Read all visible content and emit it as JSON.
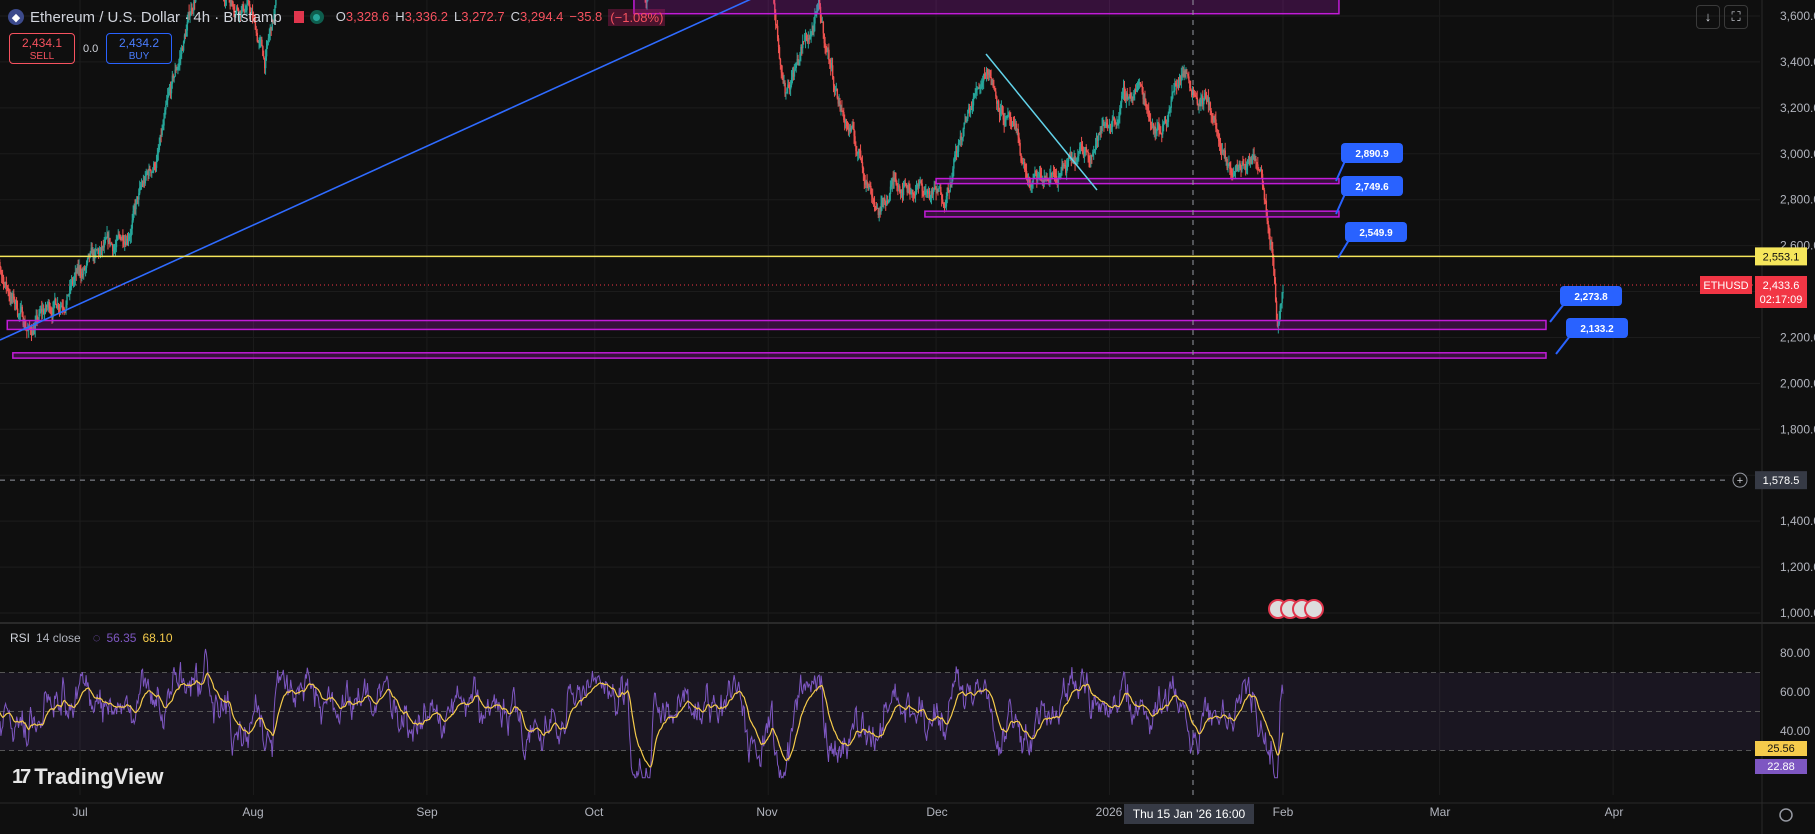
{
  "header": {
    "symbol_title": "Ethereum / U.S. Dollar · 4h · Bitstamp",
    "open_label": "O",
    "open": "3,328.6",
    "high_label": "H",
    "high": "3,336.2",
    "low_label": "L",
    "low": "3,272.7",
    "close_label": "C",
    "close": "3,294.4",
    "change": "−35.8",
    "change_pct": "(−1.08%)"
  },
  "trade": {
    "sell_price": "2,434.1",
    "sell_label": "SELL",
    "spread": "0.0",
    "buy_price": "2,434.2",
    "buy_label": "BUY"
  },
  "right_controls": {
    "down_icon": "arrow-down-icon",
    "screen_icon": "screen-icon"
  },
  "price_axis": {
    "ticks": [
      "3,600.0",
      "3,400.0",
      "3,200.0",
      "3,000.0",
      "2,800.0",
      "2,600.0",
      "2,200.0",
      "2,000.0",
      "1,800.0",
      "1,400.0",
      "1,200.0",
      "1,000.0"
    ],
    "tick_values": [
      3600,
      3400,
      3200,
      3000,
      2800,
      2600,
      2200,
      2000,
      1800,
      1400,
      1200,
      1000
    ],
    "symbol_tag": "ETHUSD",
    "last_price": "2,433.6",
    "countdown": "02:17:09",
    "yellow_level": "2,553.1",
    "crosshair_price": "1,578.5"
  },
  "time_axis": {
    "labels": [
      "Jul",
      "Aug",
      "Sep",
      "Oct",
      "Nov",
      "Dec",
      "2026",
      "Feb",
      "Mar",
      "Apr"
    ],
    "crosshair_time": "Thu 15 Jan '26   16:00"
  },
  "zone_labels": [
    "2,890.9",
    "2,749.6",
    "2,549.9",
    "2,273.8",
    "2,133.2"
  ],
  "rsi": {
    "title": "RSI",
    "params": "14 close",
    "rsi_value": "56.35",
    "ma_value": "68.10",
    "ticks": [
      "80.00",
      "60.00",
      "40.00"
    ],
    "last_ma": "25.56",
    "last_rsi": "22.88"
  },
  "branding": {
    "logo_text": "TradingView"
  },
  "colors": {
    "background": "#0f0f0f",
    "up_candle": "#26a69a",
    "down_candle": "#ef5350",
    "zone_stroke": "#c21bd8",
    "trend_line": "#2f6bff",
    "cyan_line": "#62d3ea",
    "yellow_line": "#f5e65b",
    "rsi_line": "#7e57c2",
    "rsi_ma": "#f5cb4b",
    "price_red": "#f23645",
    "label_blue": "#2962ff"
  },
  "chart_data": {
    "type": "candlestick",
    "title": "Ethereum / U.S. Dollar · 4h · Bitstamp",
    "ylim": [
      950,
      3700
    ],
    "price_path_anchors": [
      [
        "2025-06-15",
        2550
      ],
      [
        "2025-06-22",
        2230
      ],
      [
        "2025-06-30",
        2450
      ],
      [
        "2025-07-08",
        2600
      ],
      [
        "2025-07-15",
        3000
      ],
      [
        "2025-07-22",
        3750
      ],
      [
        "2025-07-31",
        3650
      ],
      [
        "2025-08-03",
        3400
      ],
      [
        "2025-08-10",
        4200
      ],
      [
        "2025-08-25",
        4600
      ],
      [
        "2025-09-01",
        4400
      ],
      [
        "2025-09-15",
        4500
      ],
      [
        "2025-09-25",
        3900
      ],
      [
        "2025-10-06",
        4700
      ],
      [
        "2025-10-10",
        3700
      ],
      [
        "2025-10-27",
        4200
      ],
      [
        "2025-11-01",
        3850
      ],
      [
        "2025-11-04",
        3300
      ],
      [
        "2025-11-10",
        3600
      ],
      [
        "2025-11-14",
        3200
      ],
      [
        "2025-11-21",
        2750
      ],
      [
        "2025-11-24",
        2900
      ],
      [
        "2025-12-02",
        2800
      ],
      [
        "2025-12-10",
        3400
      ],
      [
        "2025-12-18",
        2850
      ],
      [
        "2025-12-26",
        2950
      ],
      [
        "2026-01-06",
        3300
      ],
      [
        "2026-01-10",
        3100
      ],
      [
        "2026-01-14",
        3380
      ],
      [
        "2026-01-19",
        3200
      ],
      [
        "2026-01-22",
        2900
      ],
      [
        "2026-01-25",
        2950
      ],
      [
        "2026-01-28",
        2980
      ],
      [
        "2026-01-30",
        2650
      ],
      [
        "2026-01-31",
        2280
      ],
      [
        "2026-02-01",
        2434
      ]
    ],
    "horizontal_lines": [
      {
        "name": "yellow level",
        "value": 2553.1
      },
      {
        "name": "crosshair",
        "value": 1578.5
      }
    ],
    "zones": [
      {
        "label": "2,890.9",
        "from": 2870,
        "to": 2892,
        "start": "2025-12-01",
        "end": "2026-02-11"
      },
      {
        "label": "2,749.6",
        "from": 2725,
        "to": 2750,
        "start": "2025-11-29",
        "end": "2026-02-11"
      },
      {
        "label": "2,273.8",
        "from": 2235,
        "to": 2273.8,
        "start": "2025-06-18",
        "end": "2026-03-20"
      },
      {
        "label": "2,133.2",
        "from": 2110,
        "to": 2133.2,
        "start": "2025-06-19",
        "end": "2026-03-20"
      },
      {
        "label": "",
        "from": 3610,
        "to": 3700,
        "start": "2025-10-08",
        "end": "2026-02-11"
      }
    ],
    "rsi_series_anchors": {
      "rsi_range": [
        15,
        90
      ],
      "bands": [
        70,
        50,
        30
      ],
      "ma_last": 25.56,
      "rsi_last": 22.88
    }
  }
}
